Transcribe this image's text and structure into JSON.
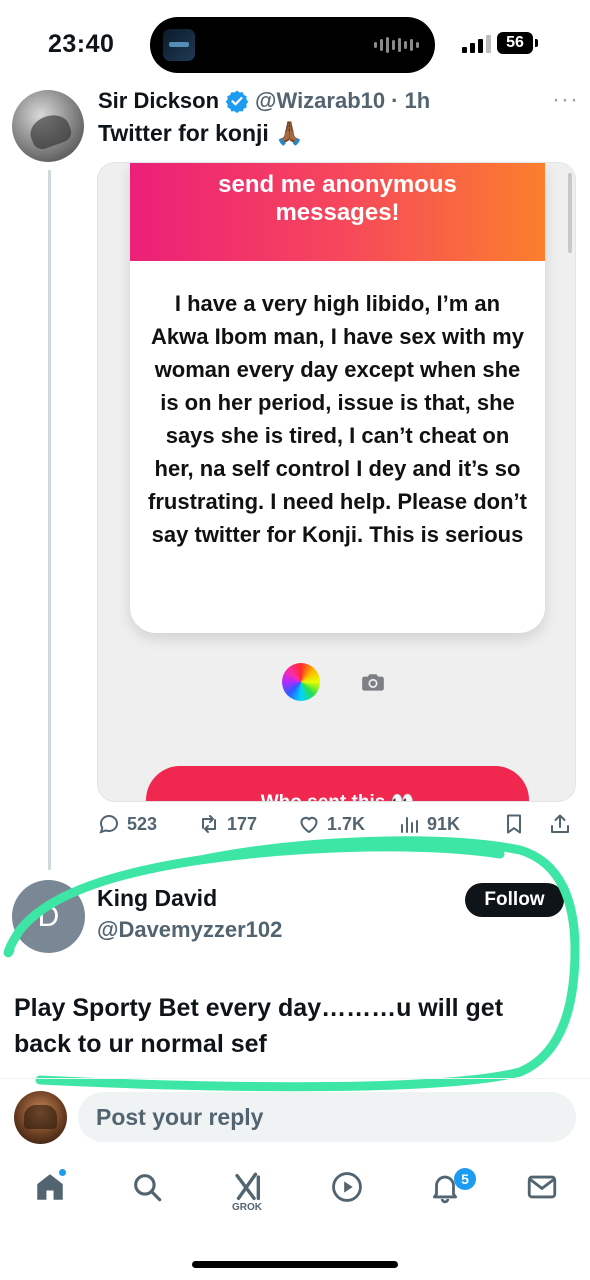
{
  "status_bar": {
    "time": "23:40",
    "battery": "56"
  },
  "tweet": {
    "author_name": "Sir Dickson",
    "handle": "@Wizarab10",
    "separator": "·",
    "time_ago": "1h",
    "more": "···",
    "text": "Twitter for konji 🙏🏾",
    "media": {
      "header": "send me anonymous messages!",
      "message": "I have a very high libido, I’m an Akwa Ibom man, I have sex with my woman every day except when she is on her period, issue is that, she says she is tired, I can’t cheat on her, na self control I dey and it’s so frustrating. I need help. Please don’t say twitter for Konji. This is serious",
      "cta": "Who sent this 👀"
    },
    "stats": {
      "replies": "523",
      "retweets": "177",
      "likes": "1.7K",
      "views": "91K"
    }
  },
  "reply": {
    "avatar_letter": "D",
    "name": "King David",
    "handle": "@Davemyzzer102",
    "follow_label": "Follow",
    "text": "Play Sporty Bet every day………u will get back to ur normal sef"
  },
  "composer": {
    "placeholder": "Post your reply"
  },
  "tabbar": {
    "grok_label": "GROK",
    "notifications_count": "5"
  },
  "colors": {
    "highlight": "#3ee6a6",
    "accent": "#1d9bf0",
    "ngl_start": "#ec1f79",
    "ngl_end": "#fb7f2d",
    "cta": "#f0284f"
  }
}
